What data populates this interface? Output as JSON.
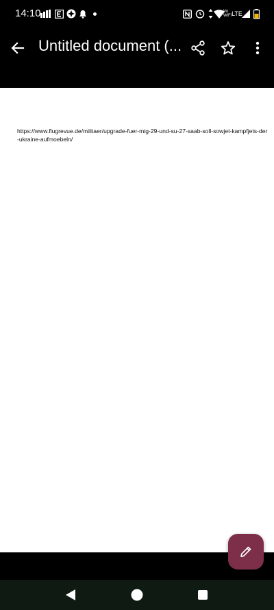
{
  "status_bar": {
    "time": "14:10",
    "icons": [
      "signal-bars-icon",
      "e-app-icon",
      "pinwheel-icon",
      "bell-icon",
      "dot-icon",
      "nfc-icon",
      "alarm-icon",
      "data-arrows-icon",
      "wifi-icon",
      "vowifi-icon",
      "lte-signal-icon",
      "battery-icon"
    ],
    "vowifi_label": "Vo WiFi",
    "network_label": "LTE"
  },
  "app_bar": {
    "title": "Untitled document (...",
    "icons": [
      "back-arrow-icon",
      "share-icon",
      "star-icon",
      "more-vert-icon"
    ]
  },
  "document": {
    "text": "https://www.flugrevue.de/militaer/upgrade-fuer-mig-29-und-su-27-saab-soll-sowjet-kampfjets-der-ukraine-aufmoebeln/"
  },
  "fab": {
    "icon": "edit-pencil-icon",
    "color": "#7d2f4a"
  },
  "nav_bar": {
    "icons": [
      "nav-back-icon",
      "nav-home-icon",
      "nav-recents-icon"
    ]
  }
}
